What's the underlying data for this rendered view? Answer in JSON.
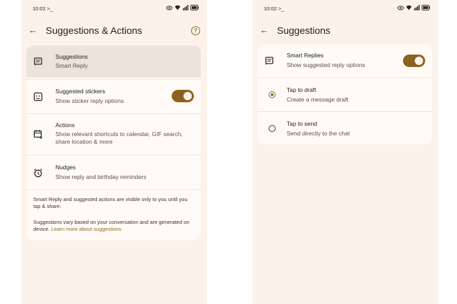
{
  "left": {
    "status": {
      "time": "10:02 >_"
    },
    "title": "Suggestions & Actions",
    "rows": [
      {
        "title": "Suggestions",
        "subtitle": "Smart Reply",
        "icon": "message-icon"
      },
      {
        "title": "Suggested stickers",
        "subtitle": "Show sticker reply options",
        "icon": "sticker-icon",
        "toggle": true
      },
      {
        "title": "Actions",
        "subtitle": "Show relevant shortcuts to calendar, GIF search, share location & more",
        "icon": "calendar-add-icon"
      },
      {
        "title": "Nudges",
        "subtitle": "Show reply and birthday reminders",
        "icon": "alarm-icon"
      }
    ],
    "footnote1": "Smart Reply and suggested actions are visible only to you until you tap & share.",
    "footnote2": "Suggestions vary based on your conversation and are generated on device.",
    "footnote_link": "Learn more about suggestions"
  },
  "right": {
    "status": {
      "time": "10:02 >_"
    },
    "title": "Suggestions",
    "smart": {
      "title": "Smart Replies",
      "subtitle": "Show suggested reply options",
      "toggle": true
    },
    "options": [
      {
        "title": "Tap to draft",
        "subtitle": "Create a message draft",
        "selected": true
      },
      {
        "title": "Tap to send",
        "subtitle": "Send directly to the chat",
        "selected": false
      }
    ]
  },
  "colors": {
    "accent": "#8c6220",
    "background": "#fdf2ea"
  }
}
